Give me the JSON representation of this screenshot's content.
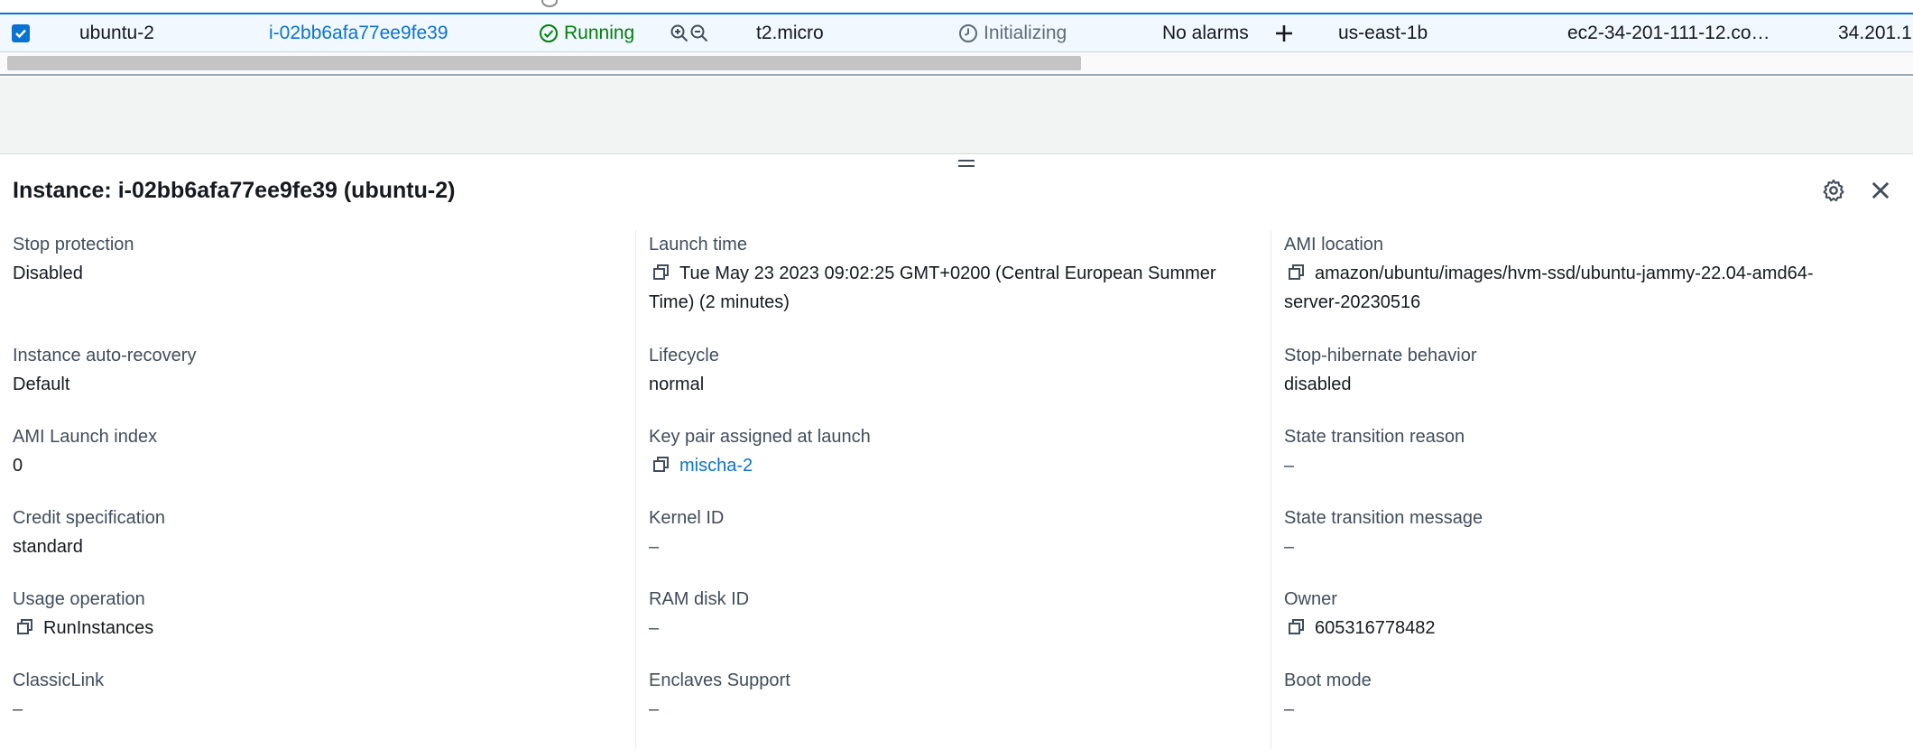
{
  "row": {
    "name": "ubuntu-2",
    "instance_id": "i-02bb6afa77ee9fe39",
    "state": "Running",
    "instance_type": "t2.micro",
    "status_check": "Initializing",
    "alarms": "No alarms",
    "availability_zone": "us-east-1b",
    "public_dns": "ec2-34-201-111-12.co…",
    "public_ip": "34.201.1"
  },
  "details": {
    "title": "Instance: i-02bb6afa77ee9fe39 (ubuntu-2)",
    "col1": [
      {
        "label": "Stop protection",
        "value": "Disabled"
      },
      {
        "label": "Instance auto-recovery",
        "value": "Default"
      },
      {
        "label": "AMI Launch index",
        "value": "0"
      },
      {
        "label": "Credit specification",
        "value": "standard"
      },
      {
        "label": "Usage operation",
        "value": "RunInstances"
      },
      {
        "label": "ClassicLink",
        "value": "–"
      }
    ],
    "col2": [
      {
        "label": "Launch time",
        "value_line1": "Tue May 23 2023 09:02:25 GMT+0200 (Central European Summer",
        "value_line2": "Time) (2 minutes)"
      },
      {
        "label": "Lifecycle",
        "value": "normal"
      },
      {
        "label": "Key pair assigned at launch",
        "value": "mischa-2"
      },
      {
        "label": "Kernel ID",
        "value": "–"
      },
      {
        "label": "RAM disk ID",
        "value": "–"
      },
      {
        "label": "Enclaves Support",
        "value": "–"
      }
    ],
    "col3": [
      {
        "label": "AMI location",
        "value_line1": "amazon/ubuntu/images/hvm-ssd/ubuntu-jammy-22.04-amd64-",
        "value_line2": "server-20230516"
      },
      {
        "label": "Stop-hibernate behavior",
        "value": "disabled"
      },
      {
        "label": "State transition reason",
        "value": "–"
      },
      {
        "label": "State transition message",
        "value": "–"
      },
      {
        "label": "Owner",
        "value": "605316778482"
      },
      {
        "label": "Boot mode",
        "value": "–"
      }
    ]
  },
  "icons": {
    "checkbox": "checkbox-checked-icon",
    "running": "check-circle-icon",
    "zoom_in": "zoom-in-icon",
    "zoom_out": "zoom-out-icon",
    "status": "clock-icon",
    "add_alarm": "plus-icon",
    "copy": "copy-icon",
    "settings": "gear-icon",
    "close": "close-icon"
  },
  "colors": {
    "selected_row_bg": "#f1f8ff",
    "link": "#0972d3",
    "running": "#037f0c"
  }
}
